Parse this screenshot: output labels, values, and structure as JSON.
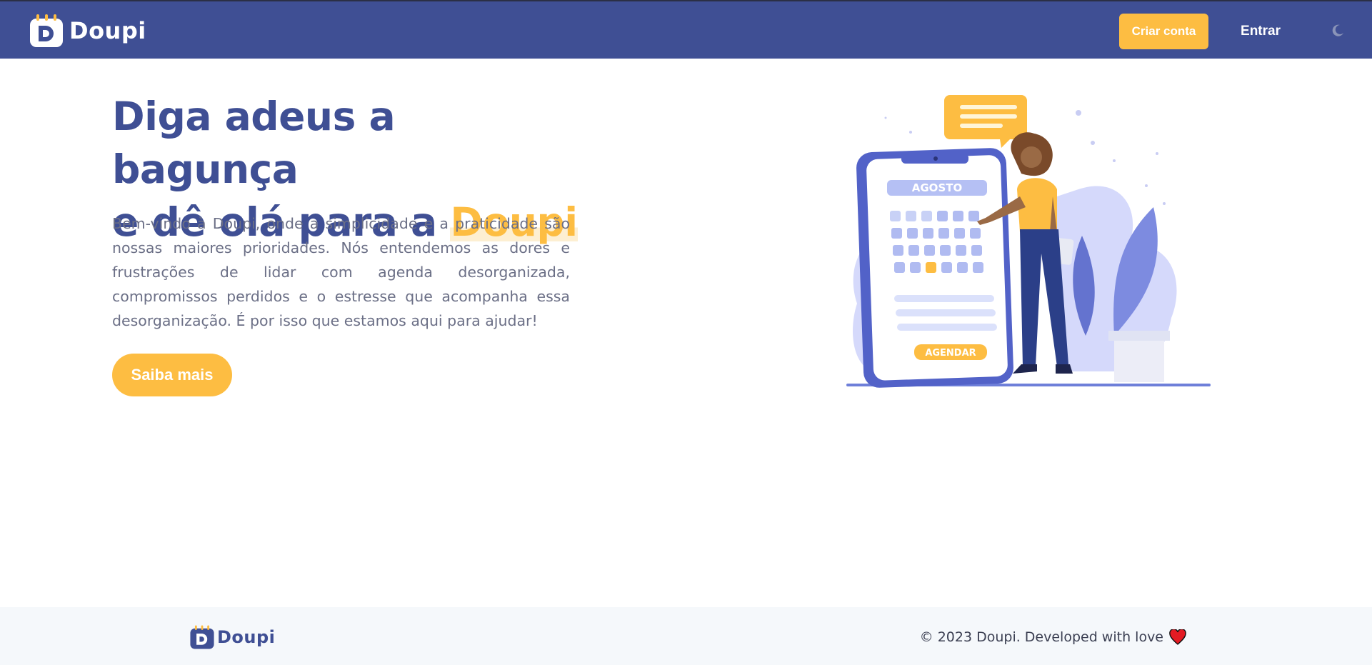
{
  "navbar": {
    "logo_text": "Doupi",
    "create_account_label": "Criar conta",
    "login_label": "Entrar",
    "theme_toggle_icon": "moon-icon"
  },
  "hero": {
    "title_line1": "Diga adeus a bagunça",
    "title_line2_prefix": "e dê olá para a ",
    "title_brand": "Doupi",
    "description": "Bem-vindo à Doupi, onde a simplicidade e a praticidade são nossas maiores prioridades. Nós entendemos as dores e frustrações de lidar com agenda desorganizada, compromissos perdidos e o estresse que acompanha essa desorganização. É por isso que estamos aqui para ajudar!",
    "cta_label": "Saiba mais"
  },
  "illustration": {
    "month_label": "AGOSTO",
    "schedule_button": "AGENDAR"
  },
  "footer": {
    "logo_text": "Doupi",
    "copyright": "© 2023 Doupi. Developed with love",
    "heart_icon": "heart-icon"
  },
  "colors": {
    "primary": "#3f4f94",
    "accent": "#fdbd42",
    "footer_bg": "#f5f8fb",
    "heart": "#e31b23"
  }
}
